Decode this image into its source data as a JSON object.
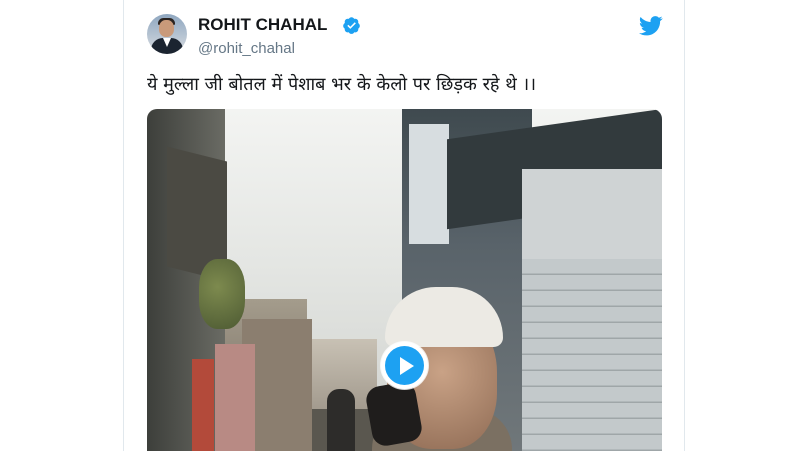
{
  "tweet": {
    "author_name": "ROHIT CHAHAL",
    "author_handle": "@rohit_chahal",
    "verified": true,
    "text": "ये मुल्ला जी बोतल में पेशाब भर के केलो पर छिड़क रहे थे ।।"
  },
  "media": {
    "type": "video",
    "play_icon": "play-icon"
  },
  "icons": {
    "brand": "twitter-bird-icon",
    "verified": "verified-badge-icon"
  },
  "colors": {
    "brand_blue": "#1da1f2",
    "text_primary": "#14171a",
    "text_secondary": "#657786"
  }
}
